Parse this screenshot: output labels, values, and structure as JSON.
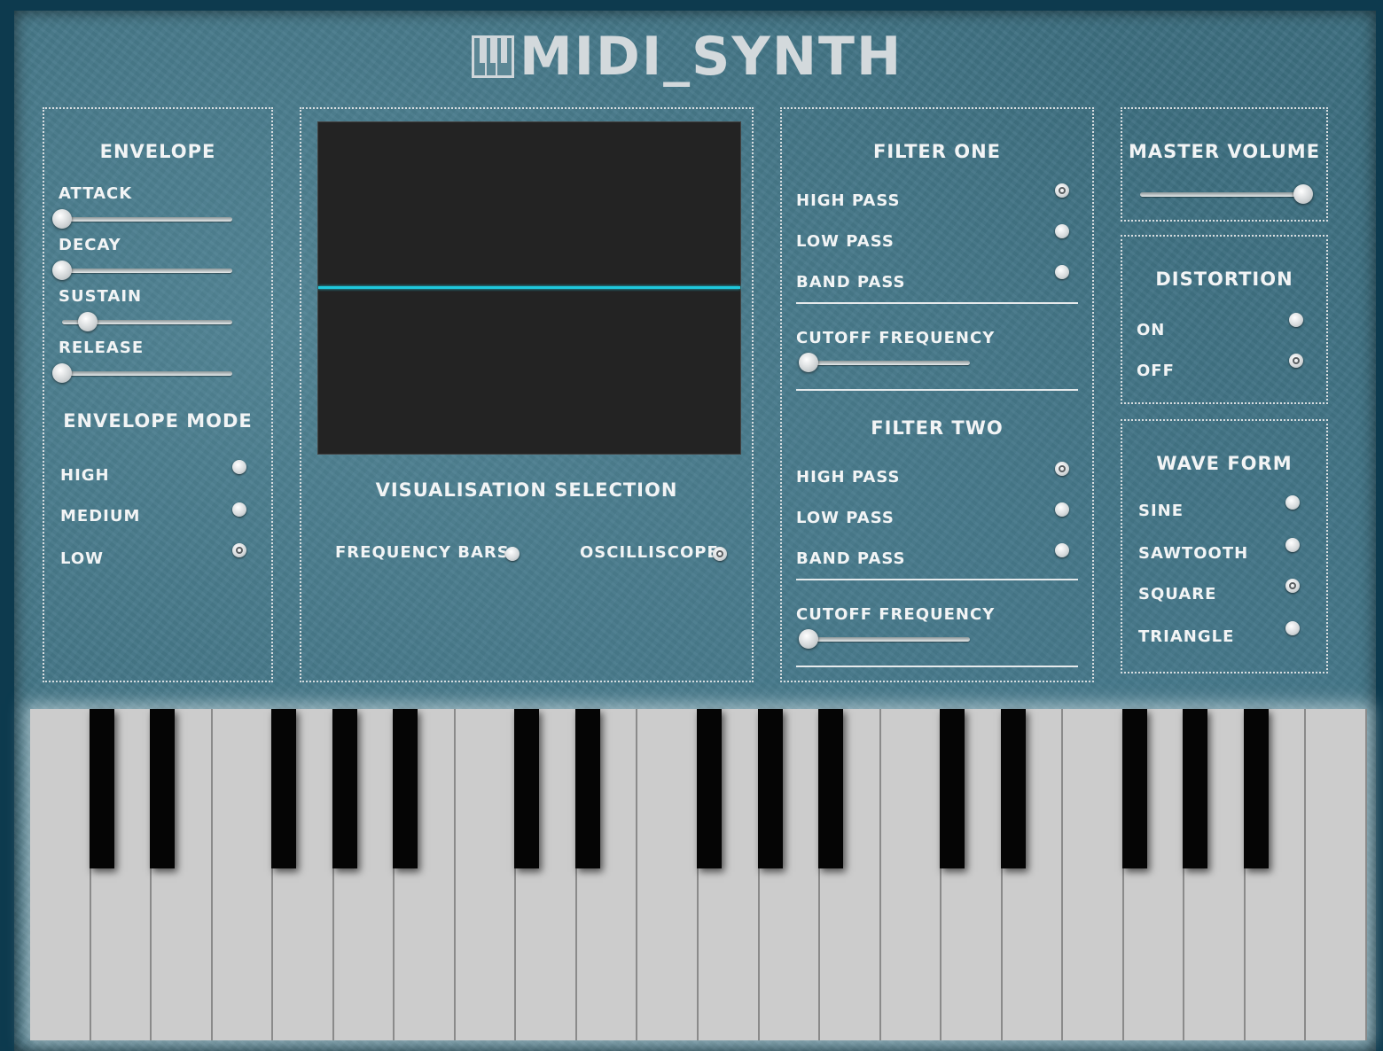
{
  "app": {
    "title": "MIDI_SYNTH",
    "logo_icon": "piano-keys-icon"
  },
  "envelope": {
    "heading": "ENVELOPE",
    "sliders": [
      {
        "label": "ATTACK",
        "value": 0.0
      },
      {
        "label": "DECAY",
        "value": 0.0
      },
      {
        "label": "SUSTAIN",
        "value": 0.15
      },
      {
        "label": "RELEASE",
        "value": 0.0
      }
    ],
    "mode_heading": "ENVELOPE MODE",
    "modes": [
      {
        "label": "HIGH",
        "checked": false
      },
      {
        "label": "MEDIUM",
        "checked": false
      },
      {
        "label": "LOW",
        "checked": true
      }
    ]
  },
  "visualisation": {
    "heading": "VISUALISATION SELECTION",
    "options": [
      {
        "label": "FREQUENCY BARS",
        "checked": false
      },
      {
        "label": "OSCILLISCOPE",
        "checked": true
      }
    ],
    "scope_bg": "#232323",
    "scope_line_color": "#1fc8dc"
  },
  "filter_one": {
    "heading": "FILTER ONE",
    "types": [
      {
        "label": "HIGH PASS",
        "checked": true
      },
      {
        "label": "LOW PASS",
        "checked": false
      },
      {
        "label": "BAND PASS",
        "checked": false
      }
    ],
    "cutoff_label": "CUTOFF FREQUENCY",
    "cutoff_value": 0.0
  },
  "filter_two": {
    "heading": "FILTER TWO",
    "types": [
      {
        "label": "HIGH PASS",
        "checked": true
      },
      {
        "label": "LOW PASS",
        "checked": false
      },
      {
        "label": "BAND PASS",
        "checked": false
      }
    ],
    "cutoff_label": "CUTOFF FREQUENCY",
    "cutoff_value": 0.0
  },
  "master_volume": {
    "heading": "MASTER VOLUME",
    "value": 1.0
  },
  "distortion": {
    "heading": "DISTORTION",
    "options": [
      {
        "label": "ON",
        "checked": false
      },
      {
        "label": "OFF",
        "checked": true
      }
    ]
  },
  "wave_form": {
    "heading": "WAVE FORM",
    "options": [
      {
        "label": "SINE",
        "checked": false
      },
      {
        "label": "SAWTOOTH",
        "checked": false
      },
      {
        "label": "SQUARE",
        "checked": true
      },
      {
        "label": "TRIANGLE",
        "checked": false
      }
    ]
  },
  "keyboard": {
    "white_key_count": 22,
    "white_color": "#cccccc",
    "black_color": "#050505"
  }
}
